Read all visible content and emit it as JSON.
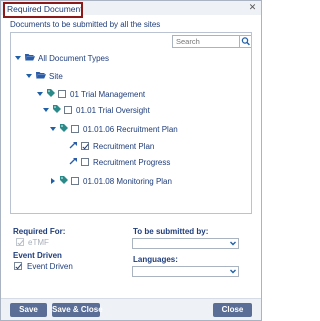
{
  "dialog": {
    "title": "Required Documents",
    "subtitle": "Documents to be submitted by all the sites"
  },
  "tree": {
    "search_placeholder": "Search",
    "nodes": [
      {
        "label": "All Document Types"
      },
      {
        "label": "Site"
      },
      {
        "label": "01 Trial Management"
      },
      {
        "label": "01.01 Trial Oversight"
      },
      {
        "label": "01.01.06 Recruitment Plan"
      },
      {
        "label": "Recruitment Plan",
        "checked": true
      },
      {
        "label": "Recruitment Progress",
        "checked": false
      },
      {
        "label": "01.01.08 Monitoring Plan"
      }
    ]
  },
  "form": {
    "required_for_label": "Required For:",
    "etmf_label": "eTMF",
    "to_be_submitted_label": "To be submitted by:",
    "to_be_submitted_value": "",
    "event_driven_label": "Event Driven",
    "event_driven_checkbox_label": "Event Driven",
    "languages_label": "Languages:",
    "languages_value": ""
  },
  "footer": {
    "save_label": "Save",
    "save_close_label": "Save & Close",
    "close_label": "Close"
  },
  "colors": {
    "accent": "#1f3d7a",
    "folder": "#2a5ca8",
    "tag": "#2a8a8a",
    "button": "#5b6f96",
    "title_border": "#8b1a1a"
  }
}
